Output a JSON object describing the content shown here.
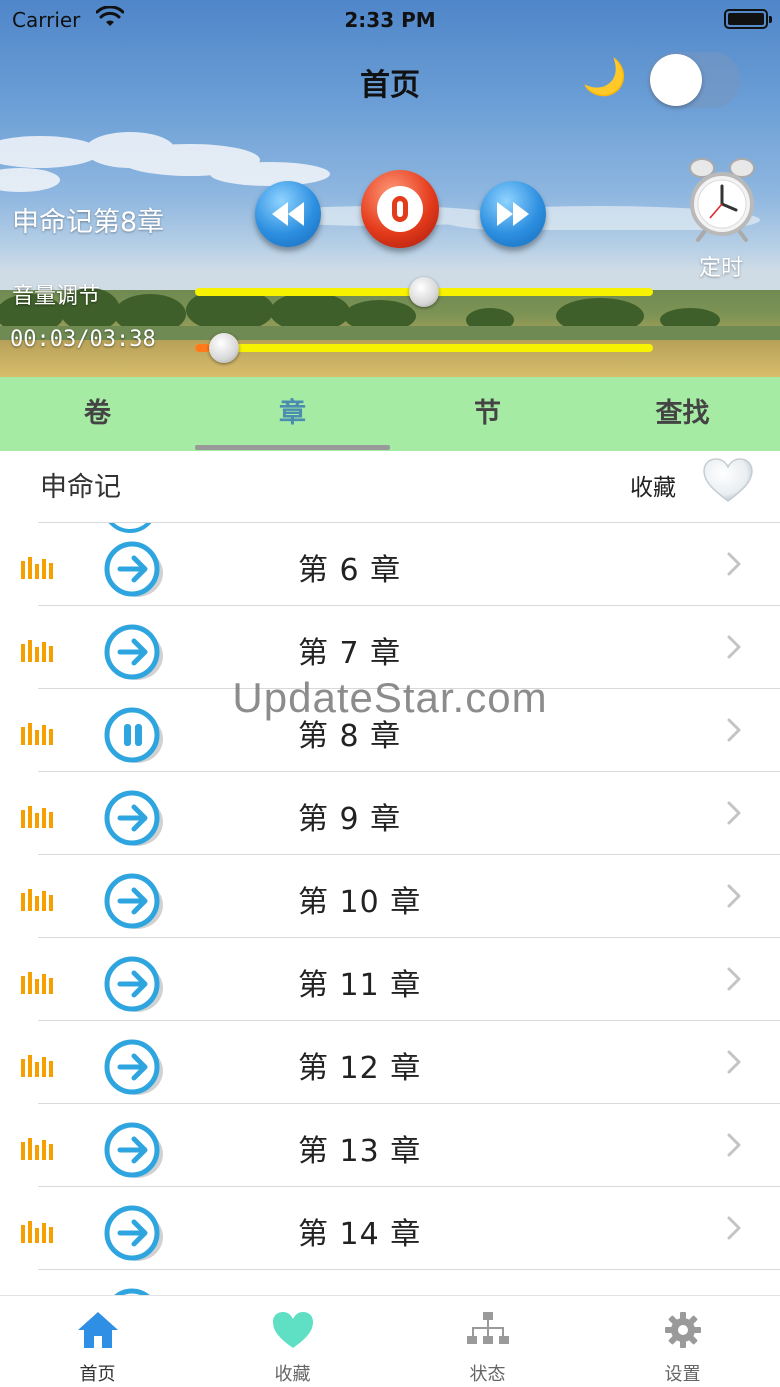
{
  "status_bar": {
    "carrier": "Carrier",
    "time": "2:33 PM"
  },
  "nav": {
    "title": "首页",
    "night_mode_icon": "moon-icon",
    "night_mode_on": false
  },
  "player": {
    "now_playing": "申命记第8章",
    "timer_label": "定时",
    "volume_label": "音量调节",
    "volume_level": 0.5,
    "time_readout": "00:03/03:38",
    "progress": 0.014
  },
  "segments": {
    "items": [
      "卷",
      "章",
      "节",
      "查找"
    ],
    "active_index": 1
  },
  "book": {
    "title": "申命记",
    "favorite_label": "收藏"
  },
  "chapters": [
    {
      "label": "第 6 章",
      "state": "play"
    },
    {
      "label": "第 7 章",
      "state": "play"
    },
    {
      "label": "第 8 章",
      "state": "pause"
    },
    {
      "label": "第 9 章",
      "state": "play"
    },
    {
      "label": "第 10 章",
      "state": "play"
    },
    {
      "label": "第 11 章",
      "state": "play"
    },
    {
      "label": "第 12 章",
      "state": "play"
    },
    {
      "label": "第 13 章",
      "state": "play"
    },
    {
      "label": "第 14 章",
      "state": "play"
    }
  ],
  "watermark": "UpdateStar.com",
  "tab_bar": {
    "items": [
      {
        "label": "首页",
        "icon": "home-icon",
        "color": "#2f8fe5"
      },
      {
        "label": "收藏",
        "icon": "heart-icon",
        "color": "#5fe0c5"
      },
      {
        "label": "状态",
        "icon": "sitemap-icon",
        "color": "#9a9a9a"
      },
      {
        "label": "设置",
        "icon": "gear-icon",
        "color": "#9a9a9a"
      }
    ],
    "active_index": 0
  },
  "colors": {
    "slider_track": "#f7f300",
    "slider_fill": "#ff7a1a",
    "segment_bg": "#a5eba4",
    "segment_active": "#4a8db0",
    "row_button": "#2fa5e0",
    "equalizer": "#f5a000"
  }
}
